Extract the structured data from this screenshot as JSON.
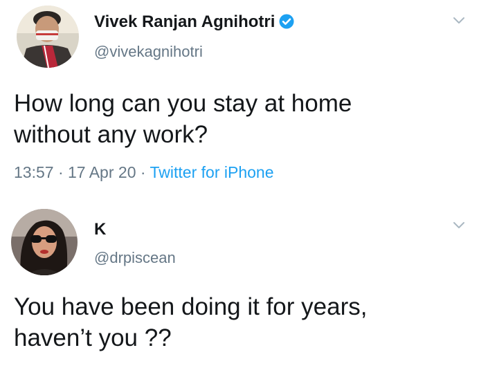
{
  "tweets": [
    {
      "author_name": "Vivek Ranjan Agnihotri",
      "verified": true,
      "handle": "@vivekagnihotri",
      "text_lines": [
        "How long can you stay at home",
        "without any work?"
      ],
      "time": "13:57",
      "separator": "·",
      "date": "17 Apr 20",
      "source": "Twitter for iPhone",
      "accent_color": "#1da1f2"
    },
    {
      "author_name": "K",
      "verified": false,
      "handle": "@drpiscean",
      "text_lines": [
        "You have been doing it for years,",
        "haven’t you ??"
      ]
    }
  ],
  "icons": {
    "verified": "verified-badge-icon",
    "menu": "chevron-down-icon"
  }
}
